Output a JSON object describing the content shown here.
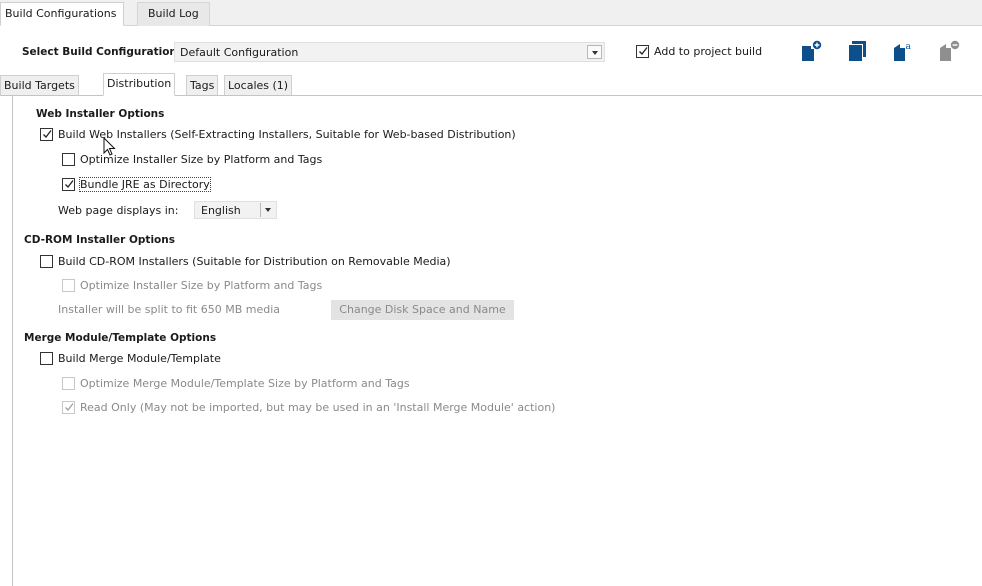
{
  "top_tabs": {
    "build_configurations": "Build Configurations",
    "build_log": "Build Log"
  },
  "toolbar": {
    "select_label": "Select Build Configuration",
    "configuration_value": "Default Configuration",
    "add_to_project_build": "Add to project build",
    "add_to_project_build_checked": true,
    "icons": [
      "new-configuration-icon",
      "copy-configuration-icon",
      "rename-configuration-icon",
      "remove-configuration-icon"
    ]
  },
  "sub_tabs": {
    "build_targets": "Build Targets",
    "distribution": "Distribution",
    "tags": "Tags",
    "locales": "Locales (1)"
  },
  "web": {
    "title": "Web Installer Options",
    "build_web": "Build Web Installers (Self-Extracting Installers, Suitable for Web-based Distribution)",
    "optimize": "Optimize Installer Size by Platform and Tags",
    "bundle_jre": "Bundle JRE as Directory",
    "displays_label": "Web page displays in:",
    "language": "English"
  },
  "cdrom": {
    "title": "CD-ROM Installer Options",
    "build_cdrom": "Build CD-ROM Installers (Suitable for Distribution on Removable Media)",
    "optimize": "Optimize Installer Size by Platform and Tags",
    "split_text": "Installer will be split to fit 650 MB  media",
    "change_button": "Change Disk Space and Name"
  },
  "merge": {
    "title": "Merge Module/Template Options",
    "build_merge": "Build Merge Module/Template",
    "optimize": "Optimize Merge Module/Template Size by Platform and Tags",
    "read_only": "Read Only (May not be imported, but may be used in an 'Install Merge Module' action)"
  },
  "colors": {
    "icon_blue": "#0d4f8b",
    "icon_gray": "#8f8f8f"
  }
}
